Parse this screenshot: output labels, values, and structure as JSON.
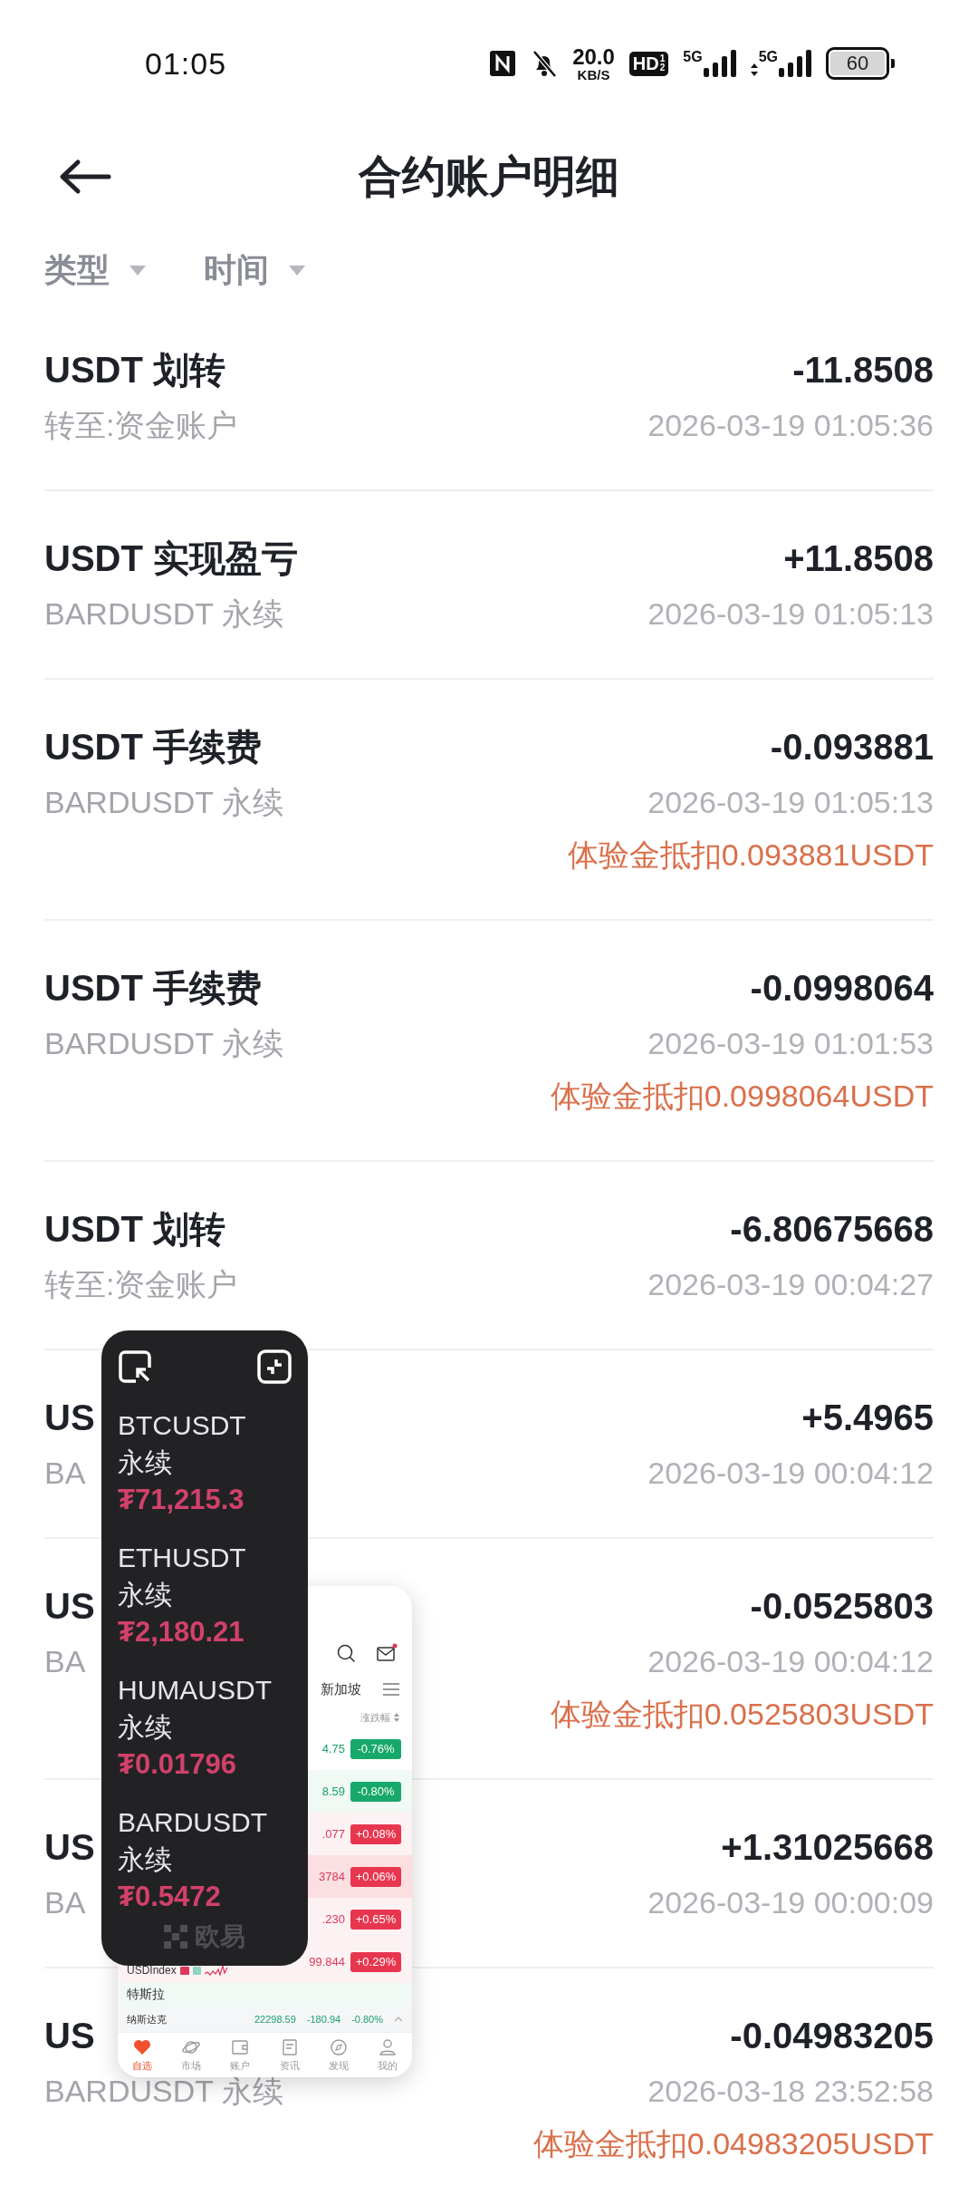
{
  "status_bar": {
    "time": "01:05",
    "net_speed_value": "20.0",
    "net_speed_unit": "KB/S",
    "hd_label": "HD",
    "hd_slots": [
      "1",
      "2"
    ],
    "sim_labels": [
      "5G",
      "5G"
    ],
    "battery": "60"
  },
  "header": {
    "title": "合约账户明细"
  },
  "filters": [
    {
      "label": "类型"
    },
    {
      "label": "时间"
    }
  ],
  "records": [
    {
      "title": "USDT 划转",
      "subtitle": "转至:资金账户",
      "amount": "-11.8508",
      "time": "2026-03-19 01:05:36"
    },
    {
      "title": "USDT 实现盈亏",
      "subtitle": "BARDUSDT 永续",
      "amount": "+11.8508",
      "time": "2026-03-19 01:05:13"
    },
    {
      "title": "USDT 手续费",
      "subtitle": "BARDUSDT 永续",
      "amount": "-0.093881",
      "time": "2026-03-19 01:05:13",
      "note": "体验金抵扣0.093881USDT"
    },
    {
      "title": "USDT 手续费",
      "subtitle": "BARDUSDT 永续",
      "amount": "-0.0998064",
      "time": "2026-03-19 01:01:53",
      "note": "体验金抵扣0.0998064USDT"
    },
    {
      "title": "USDT 划转",
      "subtitle": "转至:资金账户",
      "amount": "-6.80675668",
      "time": "2026-03-19 00:04:27"
    },
    {
      "title": "US",
      "subtitle": "BA",
      "amount": "+5.4965",
      "time": "2026-03-19 00:04:12"
    },
    {
      "title": "US",
      "subtitle": "BA",
      "amount": "-0.0525803",
      "time": "2026-03-19 00:04:12",
      "note": "体验金抵扣0.0525803USDT"
    },
    {
      "title": "US",
      "subtitle": "BA",
      "amount": "+1.31025668",
      "time": "2026-03-19 00:00:09"
    },
    {
      "title": "US",
      "subtitle": "BARDUSDT 永续",
      "amount": "-0.04983205",
      "time": "2026-03-18 23:52:58",
      "note": "体验金抵扣0.04983205USDT"
    }
  ],
  "floating_widget": {
    "items": [
      {
        "symbol": "BTCUSDT",
        "type": "永续",
        "price": "₮71,215.3"
      },
      {
        "symbol": "ETHUSDT",
        "type": "永续",
        "price": "₮2,180.21"
      },
      {
        "symbol": "HUMAUSDT",
        "type": "永续",
        "price": "₮0.01796"
      },
      {
        "symbol": "BARDUSDT",
        "type": "永续",
        "price": "₮0.5472"
      }
    ],
    "brand": "欧易"
  },
  "app_preview": {
    "region_tab": "新加坡",
    "column_header": "涨跌幅",
    "rows": [
      {
        "kind": "down",
        "price": "4.75",
        "change": "-0.76%"
      },
      {
        "kind": "down",
        "price": "8.59",
        "change": "-0.80%"
      },
      {
        "kind": "up",
        "price": ".077",
        "change": "+0.08%"
      },
      {
        "kind": "up",
        "price": "3784",
        "change": "+0.06%",
        "highlighted": true
      },
      {
        "kind": "up",
        "price": ".230",
        "change": "+0.65%"
      },
      {
        "kind": "up",
        "name": "USDIndex",
        "price": "99.844",
        "change": "+0.29%"
      },
      {
        "kind": "down",
        "name": "特斯拉"
      }
    ],
    "ticker": {
      "name": "纳斯达克",
      "price": "22298.59",
      "change": "-180.94",
      "percent": "-0.80%"
    },
    "tabs": [
      {
        "label": "自选",
        "selected": true
      },
      {
        "label": "市场",
        "selected": false
      },
      {
        "label": "账户",
        "selected": false
      },
      {
        "label": "资讯",
        "selected": false
      },
      {
        "label": "发现",
        "selected": false
      },
      {
        "label": "我的",
        "selected": false
      }
    ]
  }
}
